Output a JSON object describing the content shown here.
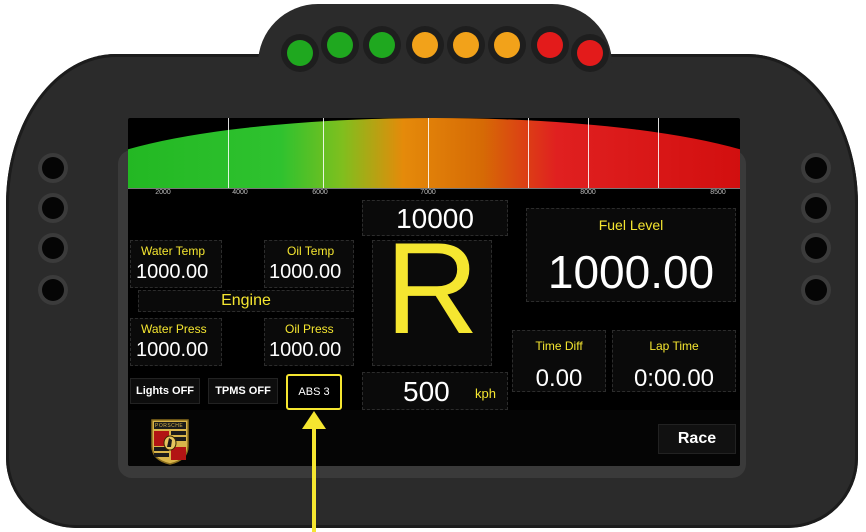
{
  "shift_lights": [
    {
      "color": "#1fa81f"
    },
    {
      "color": "#1fa81f"
    },
    {
      "color": "#1fa81f"
    },
    {
      "color": "#f2a21a"
    },
    {
      "color": "#f2a21a"
    },
    {
      "color": "#f2a21a"
    },
    {
      "color": "#e31b1b"
    },
    {
      "color": "#e31b1b"
    }
  ],
  "rpm": {
    "ticks": [
      "2000",
      "4000",
      "6000",
      "7000",
      "8000",
      "8500"
    ]
  },
  "dash": {
    "rpm_value": "10000",
    "gear": "R",
    "speed_value": "500",
    "speed_unit": "kph",
    "engine_label": "Engine",
    "water_temp_label": "Water Temp",
    "water_temp_value": "1000.00",
    "oil_temp_label": "Oil Temp",
    "oil_temp_value": "1000.00",
    "water_press_label": "Water Press",
    "water_press_value": "1000.00",
    "oil_press_label": "Oil Press",
    "oil_press_value": "1000.00",
    "fuel_label": "Fuel Level",
    "fuel_value": "1000.00",
    "time_diff_label": "Time Diff",
    "time_diff_value": "0.00",
    "lap_time_label": "Lap Time",
    "lap_time_value": "0:00.00",
    "lights_label": "Lights OFF",
    "tpms_label": "TPMS OFF",
    "abs_label": "ABS 3",
    "mode_label": "Race"
  },
  "logo": {
    "text": "PORSCHE"
  },
  "colors": {
    "accent": "#f5e630",
    "screen": "#000000",
    "housing": "#2b2b2b"
  }
}
